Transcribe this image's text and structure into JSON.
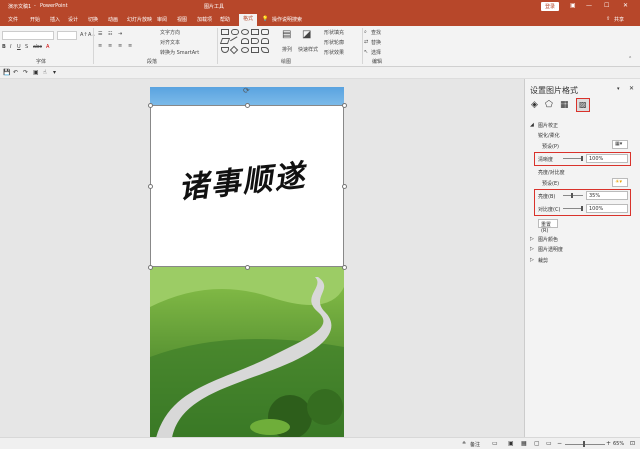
{
  "titlebar": {
    "doc_name": "演示文稿1",
    "separator": "-",
    "app_name": "PowerPoint",
    "context_tab": "图片工具",
    "login": "登录"
  },
  "tabs": [
    "文件",
    "开始",
    "插入",
    "设计",
    "切换",
    "动画",
    "幻灯片放映",
    "审阅",
    "视图",
    "加载项",
    "帮助",
    "格式",
    "操作说明搜索",
    "共享"
  ],
  "ribbon": {
    "groups": [
      "字体",
      "段落",
      "绘图",
      "编辑"
    ],
    "paragraph_items": [
      "文字方向",
      "对齐文本",
      "转换为 SmartArt"
    ],
    "drawing_items": [
      "排列",
      "快速样式",
      "形状填充",
      "形状轮廓",
      "形状效果"
    ],
    "editing_items": [
      "查找",
      "替换",
      "选择"
    ]
  },
  "slide": {
    "calligraphy_text": "诸事顺遂"
  },
  "panel": {
    "title": "设置图片格式",
    "section_correction": "图片校正",
    "sharpen_label": "锐化/柔化",
    "preset_label": "预设(P)",
    "sharpness_label": "清晰度",
    "sharpness_value": "100%",
    "brightness_contrast_label": "亮度/对比度",
    "preset2_label": "预设(E)",
    "brightness_label": "亮度(B)",
    "brightness_value": "35%",
    "contrast_label": "对比度(C)",
    "contrast_value": "100%",
    "reset_label": "重置(R)",
    "section_color": "图片颜色",
    "section_transparency": "图片透明度",
    "section_crop": "裁剪"
  },
  "status": {
    "notes": "备注",
    "zoom": "65%"
  },
  "colors": {
    "accent": "#b7472a",
    "highlight": "#d9322b"
  }
}
